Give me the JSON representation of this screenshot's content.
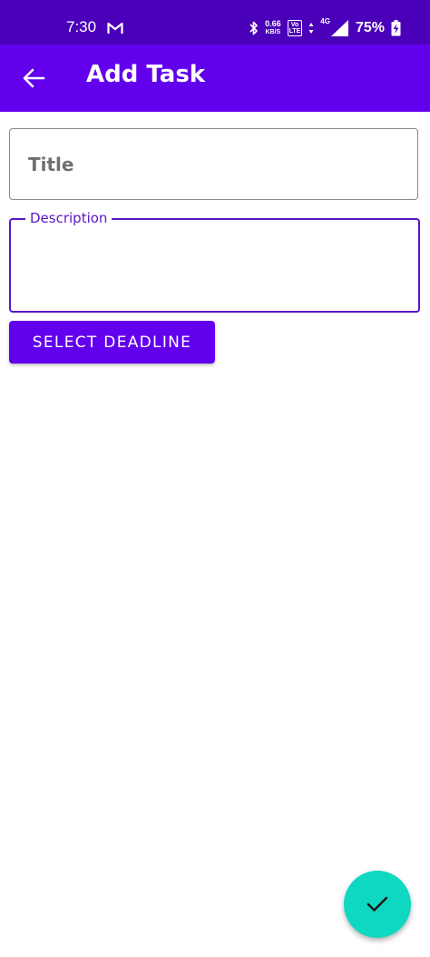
{
  "status_bar": {
    "time": "7:30",
    "net_speed_value": "0.66",
    "net_speed_unit": "KB/S",
    "volte_top": "Vo",
    "volte_bottom": "LTE",
    "network_type": "4G",
    "battery_percent": "75%",
    "icons": [
      "gmail-icon",
      "bluetooth-icon",
      "data-arrows-icon",
      "signal-icon",
      "battery-charging-icon"
    ]
  },
  "app_bar": {
    "title": "Add Task",
    "back_icon": "arrow-left-icon"
  },
  "form": {
    "title_placeholder": "Title",
    "title_value": "",
    "description_label": "Description",
    "description_value": "",
    "deadline_button_label": "SELECT DEADLINE"
  },
  "fab": {
    "icon": "check-icon"
  },
  "colors": {
    "status_bar": "#4a00b8",
    "primary": "#6200ee",
    "focus_outline": "#5a16c8",
    "fab": "#0fd8c2"
  }
}
